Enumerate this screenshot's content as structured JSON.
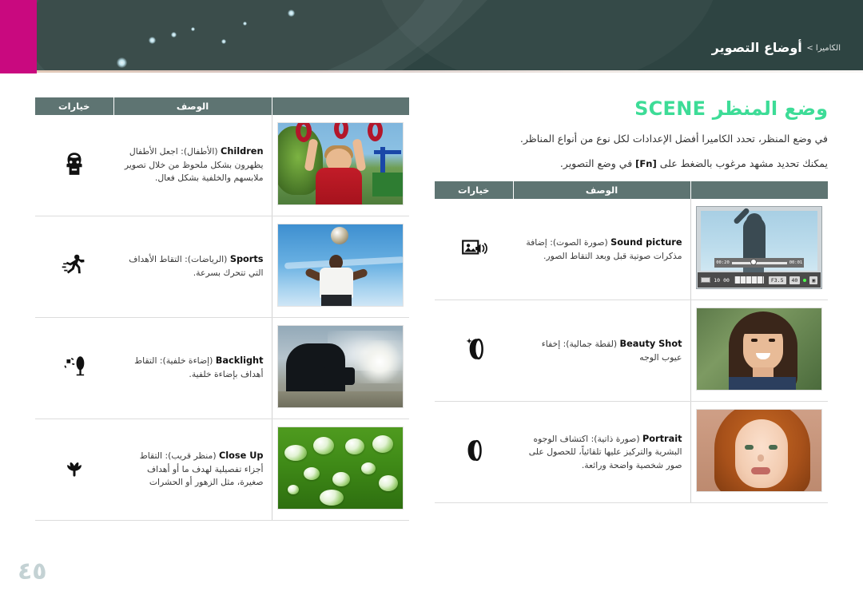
{
  "header": {
    "breadcrumb_parent": "الكاميرا >",
    "breadcrumb_current": "أوضاع التصوير"
  },
  "page_number": "٤٥",
  "section": {
    "title_mode": "SCENE",
    "title_text": "وضع المنظر",
    "paragraph1": "في وضع المنظر، تحدد الكاميرا أفضل الإعدادات لكل نوع من أنواع المناظر.",
    "paragraph2_before": "يمكنك تحديد مشهد مرغوب بالضغط على ",
    "paragraph2_key": "[Fn]",
    "paragraph2_after": " في وضع التصوير."
  },
  "table_headers": {
    "options": "خيارات",
    "description": "الوصف"
  },
  "left_table": {
    "rows": [
      {
        "icon": "child-icon",
        "title": "Children",
        "title_ar": "(الأطفال)",
        "description": ": اجعل الأطفال يظهرون بشكل ملحوظ من خلال تصوير ملابسهم والخلفية بشكل فعال.",
        "photo": "children-playground-photo"
      },
      {
        "icon": "running-person-icon",
        "title": "Sports",
        "title_ar": "(الرياضات)",
        "description": ": التقاط الأهداف التي تتحرك بسرعة.",
        "photo": "sports-header-ball-photo"
      },
      {
        "icon": "backlight-tree-sun-icon",
        "title": "Backlight",
        "title_ar": "(إضاءة خلفية)",
        "description": ": التقاط أهداف بإضاءة خلفية.",
        "photo": "backlit-silhouette-photo"
      },
      {
        "icon": "flower-macro-icon",
        "title": "Close Up",
        "title_ar": "(منظر قريب)",
        "description": ": التقاط أجزاء تفصيلية لهدف ما أو أهداف صغيرة، مثل الزهور أو الحشرات",
        "photo": "dewdrops-leaf-photo"
      }
    ]
  },
  "right_table": {
    "rows": [
      {
        "icon": "sound-picture-icon",
        "title": "Sound picture",
        "title_ar": "(صورة الصوت)",
        "description": ": إضافة مذكرات صوتية قبل وبعد التقاط الصور.",
        "photo": "camera-lcd-sound-recording-photo"
      },
      {
        "icon": "beauty-shot-icon",
        "title": "Beauty Shot",
        "title_ar": "(لقطة جمالية)",
        "description": ": إخفاء عيوب الوجه",
        "photo": "woman-smiling-photo"
      },
      {
        "icon": "portrait-face-icon",
        "title": "Portrait",
        "title_ar": "(صورة ذاتية)",
        "description": ": اكتشاف الوجوه البشرية والتركيز عليها تلقائياً، للحصول على صور شخصية واضحة ورائعة.",
        "photo": "child-portrait-photo"
      }
    ]
  },
  "lcd_overlay": {
    "time_elapsed": "00:01",
    "time_total": "00:20",
    "iso": "40",
    "aperture": "F3.5",
    "shots_left": "00",
    "count": "10"
  },
  "colors": {
    "accent_green": "#3ddc97",
    "banner_dark": "#2e4442",
    "magenta": "#c9097f",
    "table_header": "#5e7472"
  }
}
